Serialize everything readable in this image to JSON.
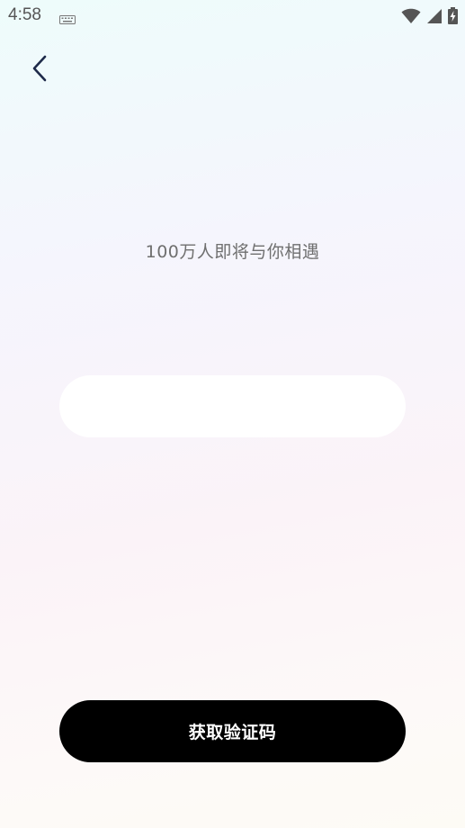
{
  "status_bar": {
    "time": "4:58",
    "icons": [
      "keyboard-icon",
      "wifi-icon",
      "cell-signal-icon",
      "battery-charging-icon"
    ],
    "icon_color": "#555555"
  },
  "header": {
    "back_icon": "chevron-left-icon",
    "back_icon_color": "#1e2a4a"
  },
  "main": {
    "tagline": "100万人即将与你相遇",
    "phone_input": {
      "value": "",
      "placeholder": ""
    },
    "submit_button": {
      "label": "获取验证码",
      "background": "#000000",
      "text_color": "#ffffff"
    }
  }
}
